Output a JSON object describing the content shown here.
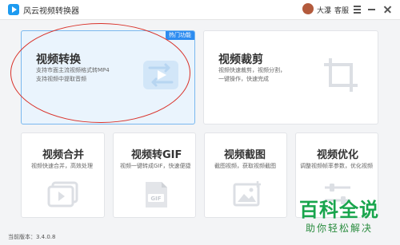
{
  "app": {
    "title": "风云视频转换器"
  },
  "user": {
    "name": "大瀑",
    "service": "客服"
  },
  "cards": [
    {
      "title": "视频转换",
      "desc_lines": [
        "支持市面主流视频格式转MP4",
        "支持视频中提取音频"
      ],
      "badge": "热门功能",
      "icon": "convert-icon"
    },
    {
      "title": "视频裁剪",
      "desc_lines": [
        "视频快速裁剪，视频分割，",
        "一键操作，快速完成"
      ],
      "icon": "crop-icon"
    },
    {
      "title": "视频合并",
      "desc_lines": [
        "视频快速合并，高效处理"
      ],
      "icon": "merge-icon"
    },
    {
      "title": "视频转GIF",
      "desc_lines": [
        "视频一键转成GIF，快速便捷"
      ],
      "icon": "gif-icon"
    },
    {
      "title": "视频截图",
      "desc_lines": [
        "截图视频，获取视频截图"
      ],
      "icon": "screenshot-icon"
    },
    {
      "title": "视频优化",
      "desc_lines": [
        "调整视频帧率参数，优化视频"
      ],
      "icon": "optimize-icon"
    }
  ],
  "footer": {
    "version": "当前版本：3.4.0.8"
  },
  "watermark": {
    "title": "百科全说",
    "subtitle": "助你轻松解决"
  },
  "colors": {
    "accent": "#2d8cf0",
    "annotation": "#d9322a",
    "watermark": "#19a54d"
  }
}
